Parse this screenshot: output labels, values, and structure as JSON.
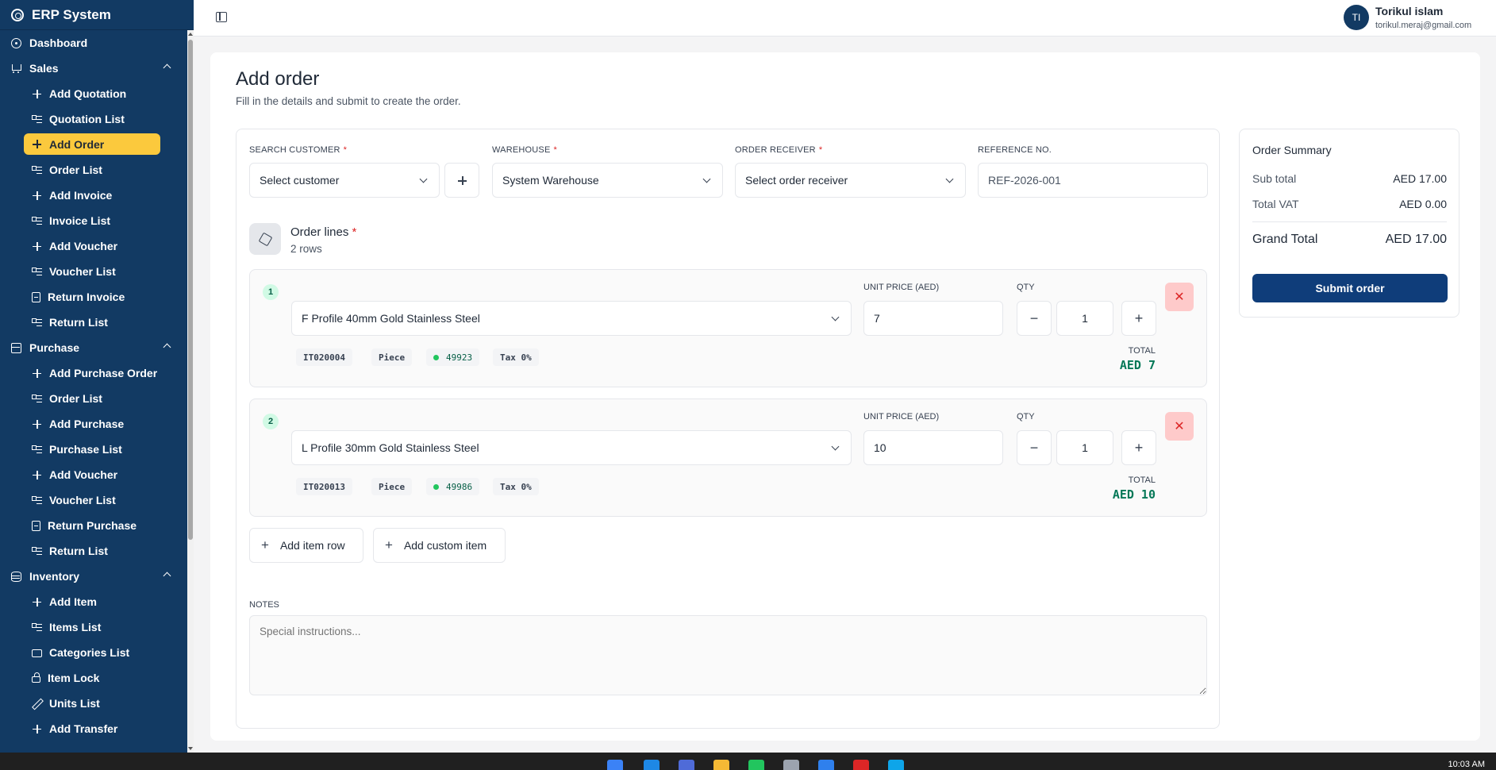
{
  "app": {
    "title": "ERP System"
  },
  "sidebar": {
    "dashboard": "Dashboard",
    "sales": {
      "label": "Sales",
      "items": [
        "Add Quotation",
        "Quotation List",
        "Add Order",
        "Order List",
        "Add Invoice",
        "Invoice List",
        "Add Voucher",
        "Voucher List",
        "Return Invoice",
        "Return List"
      ]
    },
    "purchase": {
      "label": "Purchase",
      "items": [
        "Add Purchase Order",
        "Order List",
        "Add Purchase",
        "Purchase List",
        "Add Voucher",
        "Voucher List",
        "Return Purchase",
        "Return List"
      ]
    },
    "inventory": {
      "label": "Inventory",
      "items": [
        "Add Item",
        "Items List",
        "Categories List",
        "Item Lock",
        "Units List",
        "Add Transfer"
      ]
    }
  },
  "user": {
    "initials": "TI",
    "name": "Torikul islam",
    "email": "torikul.meraj@gmail.com"
  },
  "page": {
    "title": "Add order",
    "subtitle": "Fill in the details and submit to create the order."
  },
  "form": {
    "customer_label": "SEARCH CUSTOMER",
    "customer_value": "Select customer",
    "warehouse_label": "WAREHOUSE",
    "warehouse_value": "System Warehouse",
    "receiver_label": "ORDER RECEIVER",
    "receiver_value": "Select order receiver",
    "reference_label": "REFERENCE NO.",
    "reference_value": "REF-2026-001",
    "required_mark": "*",
    "add_customer": "+"
  },
  "order_lines": {
    "title": "Order lines",
    "rows_text": "2 rows",
    "unit_price_label": "UNIT PRICE (AED)",
    "qty_label": "QTY",
    "total_label": "TOTAL",
    "minus": "−",
    "plus": "+",
    "remove": "✕",
    "lines": [
      {
        "num": "1",
        "product": "F Profile 40mm Gold Stainless Steel",
        "price": "7",
        "qty": "1",
        "code": "IT020004",
        "unit": "Piece",
        "stock": "49923",
        "tax": "Tax 0%",
        "total": "AED 7"
      },
      {
        "num": "2",
        "product": "L Profile 30mm Gold Stainless Steel",
        "price": "10",
        "qty": "1",
        "code": "IT020013",
        "unit": "Piece",
        "stock": "49986",
        "tax": "Tax 0%",
        "total": "AED 10"
      }
    ],
    "add_item_row": "Add item row",
    "add_custom_item": "Add custom item"
  },
  "notes": {
    "label": "NOTES",
    "placeholder": "Special instructions..."
  },
  "summary": {
    "title": "Order Summary",
    "subtotal_label": "Sub total",
    "subtotal_value": "AED 17.00",
    "vat_label": "Total VAT",
    "vat_value": "AED 0.00",
    "grand_label": "Grand Total",
    "grand_value": "AED 17.00",
    "submit": "Submit order"
  },
  "taskbar": {
    "clock": "10:03 AM"
  },
  "colors": {
    "sidebar": "#123a63",
    "active": "#fbc93d",
    "primary": "#0f3d7a",
    "success": "#047857",
    "danger": "#dc2626"
  }
}
